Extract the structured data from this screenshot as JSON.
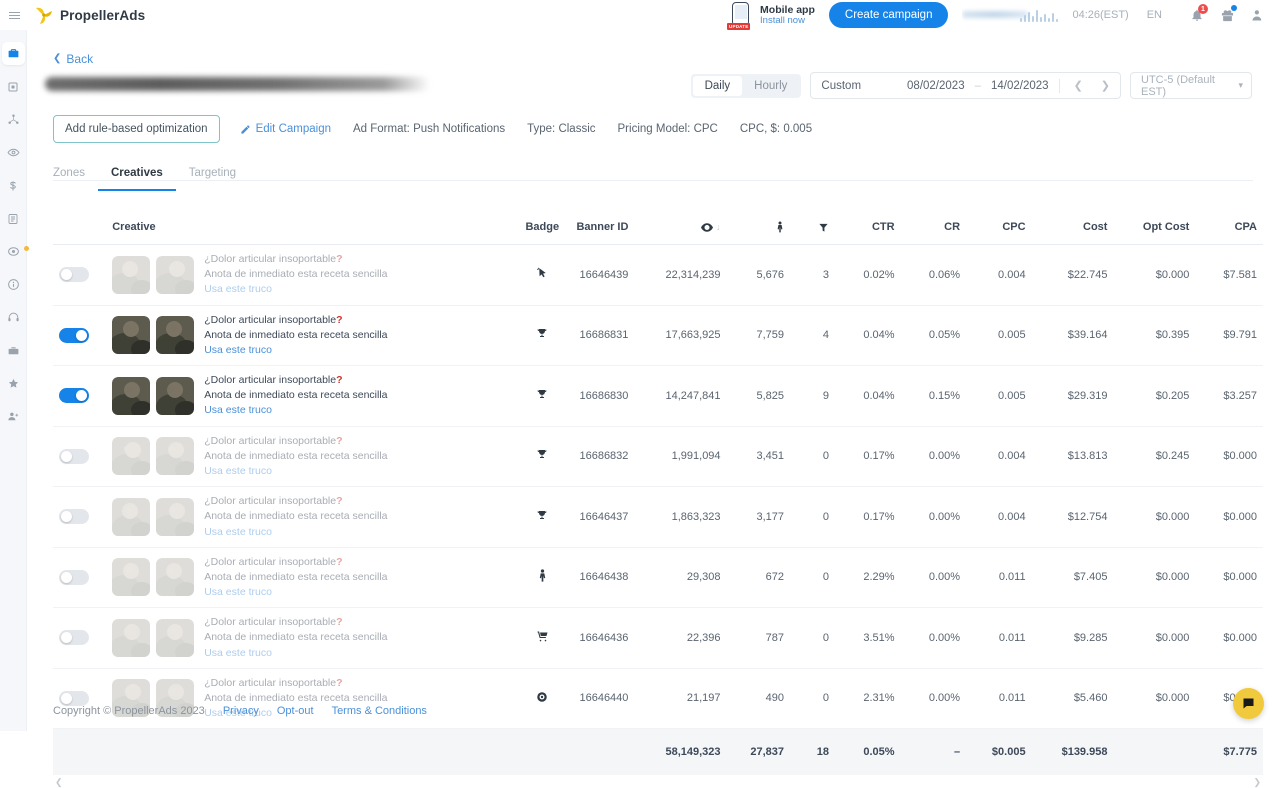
{
  "topbar": {
    "menu_icon": "hamburger-icon",
    "brand": "PropellerAds",
    "mobile_app": {
      "title": "Mobile app",
      "link": "Install now",
      "badge": "UPDATE"
    },
    "create_campaign": "Create campaign",
    "balance": "",
    "time": "04:26(EST)",
    "language": "EN",
    "notifications_count": "1",
    "icons": [
      "bell-icon",
      "gift-icon",
      "user-icon"
    ]
  },
  "sidebar": {
    "items": [
      {
        "name": "campaigns",
        "icon": "briefcase-icon",
        "active": true,
        "dot": false
      },
      {
        "name": "statistics",
        "icon": "monitor-icon",
        "active": false,
        "dot": false
      },
      {
        "name": "audiences",
        "icon": "share-nodes-icon",
        "active": false,
        "dot": false
      },
      {
        "name": "zones",
        "icon": "eye-icon",
        "active": false,
        "dot": false
      },
      {
        "name": "finances",
        "icon": "dollar-icon",
        "active": false,
        "dot": false
      },
      {
        "name": "reports",
        "icon": "document-icon",
        "active": false,
        "dot": false
      },
      {
        "name": "tracking",
        "icon": "target-icon",
        "active": false,
        "dot": true
      },
      {
        "name": "help",
        "icon": "info-icon",
        "active": false,
        "dot": false
      },
      {
        "name": "support",
        "icon": "headset-icon",
        "active": false,
        "dot": false
      },
      {
        "name": "tools",
        "icon": "toolbox-icon",
        "active": false,
        "dot": false
      },
      {
        "name": "favorites",
        "icon": "star-icon",
        "active": false,
        "dot": false
      },
      {
        "name": "referrals",
        "icon": "user-add-icon",
        "active": false,
        "dot": false
      }
    ]
  },
  "page": {
    "back_label": "Back",
    "campaign_title_hidden": "",
    "add_rule_button": "Add rule-based optimization",
    "edit_campaign": "Edit Campaign",
    "meta": [
      "Ad Format: Push Notifications",
      "Type: Classic",
      "Pricing Model: CPC",
      "CPC, $: 0.005"
    ],
    "tabs": [
      {
        "label": "Zones",
        "active": false
      },
      {
        "label": "Creatives",
        "active": true
      },
      {
        "label": "Targeting",
        "active": false
      }
    ]
  },
  "date_controls": {
    "granularity": [
      {
        "label": "Daily",
        "active": true
      },
      {
        "label": "Hourly",
        "active": false
      }
    ],
    "range_label": "Custom",
    "date_from": "08/02/2023",
    "date_to": "14/02/2023",
    "separator": "–",
    "prev_icon": "chevron-left-icon",
    "next_icon": "chevron-right-icon",
    "timezone": "UTC-5 (Default EST)"
  },
  "table": {
    "columns": [
      {
        "key": "toggle",
        "label": "",
        "align": "c"
      },
      {
        "key": "creative",
        "label": "Creative",
        "align": "l"
      },
      {
        "key": "badge",
        "label": "Badge",
        "align": "c"
      },
      {
        "key": "banner_id",
        "label": "Banner ID",
        "align": "r"
      },
      {
        "key": "impressions",
        "label": "",
        "icon": "eye-icon",
        "sorted": true,
        "align": "r"
      },
      {
        "key": "clicks",
        "label": "",
        "icon": "click-icon",
        "align": "r"
      },
      {
        "key": "conversions",
        "label": "",
        "icon": "funnel-icon",
        "align": "r"
      },
      {
        "key": "ctr",
        "label": "CTR",
        "align": "r"
      },
      {
        "key": "cr",
        "label": "CR",
        "align": "r"
      },
      {
        "key": "cpc",
        "label": "CPC",
        "align": "r"
      },
      {
        "key": "cost",
        "label": "Cost",
        "align": "r"
      },
      {
        "key": "opt_cost",
        "label": "Opt Cost",
        "align": "r"
      },
      {
        "key": "cpa",
        "label": "CPA",
        "align": "r"
      }
    ],
    "creative_text": {
      "line1": "¿Dolor articular insoportable",
      "line1_mark": "?",
      "line2": "Anota de inmediato esta receta sencilla",
      "line3": "Usa este truco"
    },
    "rows": [
      {
        "enabled": false,
        "badge": "cursor-click-icon",
        "banner_id": "16646439",
        "impressions": "22,314,239",
        "clicks": "5,676",
        "conversions": "3",
        "ctr": "0.02%",
        "cr": "0.06%",
        "cpc": "0.004",
        "cost": "$22.745",
        "opt_cost": "$0.000",
        "cpa": "$7.581"
      },
      {
        "enabled": true,
        "badge": "trophy-icon",
        "banner_id": "16686831",
        "impressions": "17,663,925",
        "clicks": "7,759",
        "conversions": "4",
        "ctr": "0.04%",
        "cr": "0.05%",
        "cpc": "0.005",
        "cost": "$39.164",
        "opt_cost": "$0.395",
        "cpa": "$9.791"
      },
      {
        "enabled": true,
        "badge": "trophy-icon",
        "banner_id": "16686830",
        "impressions": "14,247,841",
        "clicks": "5,825",
        "conversions": "9",
        "ctr": "0.04%",
        "cr": "0.15%",
        "cpc": "0.005",
        "cost": "$29.319",
        "opt_cost": "$0.205",
        "cpa": "$3.257"
      },
      {
        "enabled": false,
        "badge": "trophy-icon",
        "banner_id": "16686832",
        "impressions": "1,991,094",
        "clicks": "3,451",
        "conversions": "0",
        "ctr": "0.17%",
        "cr": "0.00%",
        "cpc": "0.004",
        "cost": "$13.813",
        "opt_cost": "$0.245",
        "cpa": "$0.000"
      },
      {
        "enabled": false,
        "badge": "trophy-icon",
        "banner_id": "16646437",
        "impressions": "1,863,323",
        "clicks": "3,177",
        "conversions": "0",
        "ctr": "0.17%",
        "cr": "0.00%",
        "cpc": "0.004",
        "cost": "$12.754",
        "opt_cost": "$0.000",
        "cpa": "$0.000"
      },
      {
        "enabled": false,
        "badge": "click-icon",
        "banner_id": "16646438",
        "impressions": "29,308",
        "clicks": "672",
        "conversions": "0",
        "ctr": "2.29%",
        "cr": "0.00%",
        "cpc": "0.011",
        "cost": "$7.405",
        "opt_cost": "$0.000",
        "cpa": "$0.000"
      },
      {
        "enabled": false,
        "badge": "cart-icon",
        "banner_id": "16646436",
        "impressions": "22,396",
        "clicks": "787",
        "conversions": "0",
        "ctr": "3.51%",
        "cr": "0.00%",
        "cpc": "0.011",
        "cost": "$9.285",
        "opt_cost": "$0.000",
        "cpa": "$0.000"
      },
      {
        "enabled": false,
        "badge": "target-icon",
        "banner_id": "16646440",
        "impressions": "21,197",
        "clicks": "490",
        "conversions": "0",
        "ctr": "2.31%",
        "cr": "0.00%",
        "cpc": "0.011",
        "cost": "$5.460",
        "opt_cost": "$0.000",
        "cpa": "$0.000"
      }
    ],
    "totals": {
      "impressions": "58,149,323",
      "clicks": "27,837",
      "conversions": "18",
      "ctr": "0.05%",
      "cr": "–",
      "cpc": "$0.005",
      "cost": "$139.958",
      "opt_cost": "",
      "cpa": "$7.775"
    }
  },
  "footer": {
    "copyright": "Copyright © PropellerAds 2023",
    "links": [
      "Privacy",
      "Opt-out",
      "Terms & Conditions"
    ]
  },
  "colors": {
    "accent": "#1583e8",
    "link": "#4a90d9",
    "brand_yellow": "#f0c93c",
    "toggle_on": "#1583e8"
  }
}
